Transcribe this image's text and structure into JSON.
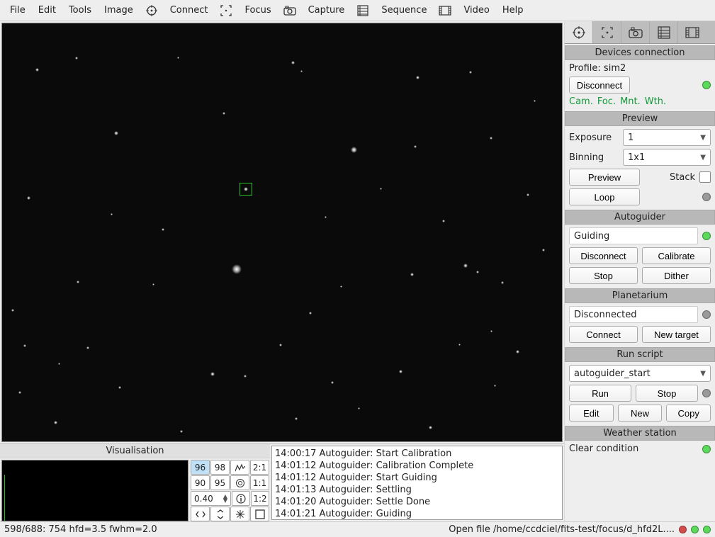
{
  "menu": {
    "file": "File",
    "edit": "Edit",
    "tools": "Tools",
    "image": "Image",
    "connect": "Connect",
    "focus": "Focus",
    "capture": "Capture",
    "sequence": "Sequence",
    "video": "Video",
    "help": "Help"
  },
  "tabs": {
    "active_index": 0
  },
  "devices": {
    "title": "Devices connection",
    "profile_label": "Profile: sim2",
    "disconnect": "Disconnect",
    "status_line": {
      "cam": "Cam.",
      "foc": "Foc.",
      "mnt": "Mnt.",
      "wth": "Wth."
    },
    "led": "green"
  },
  "preview": {
    "title": "Preview",
    "exposure_label": "Exposure",
    "exposure_value": "1",
    "binning_label": "Binning",
    "binning_value": "1x1",
    "preview_btn": "Preview",
    "stack_label": "Stack",
    "loop_btn": "Loop",
    "loop_led": "gray"
  },
  "autoguider": {
    "title": "Autoguider",
    "status_text": "Guiding",
    "status_led": "green",
    "disconnect": "Disconnect",
    "calibrate": "Calibrate",
    "stop": "Stop",
    "dither": "Dither"
  },
  "planetarium": {
    "title": "Planetarium",
    "status_text": "Disconnected",
    "status_led": "gray",
    "connect": "Connect",
    "newtarget": "New target"
  },
  "runscript": {
    "title": "Run script",
    "script_value": "autoguider_start",
    "run": "Run",
    "stop": "Stop",
    "led": "gray",
    "edit": "Edit",
    "new": "New",
    "copy": "Copy"
  },
  "weather": {
    "title": "Weather station",
    "status_text": "Clear condition",
    "led": "green"
  },
  "visualisation": {
    "title": "Visualisation",
    "btns": {
      "b96": "96",
      "b98": "98",
      "ratio21": "2:1",
      "b90": "90",
      "b95": "95",
      "ratio11": "1:1",
      "spin": "0.40",
      "ratio12": "1:2"
    }
  },
  "log": [
    "14:00:17 Autoguider: Start Calibration",
    "14:01:12 Autoguider: Calibration Complete",
    "14:01:12 Autoguider: Start Guiding",
    "14:01:13 Autoguider: Settling",
    "14:01:20 Autoguider: Settle Done",
    "14:01:21 Autoguider: Guiding"
  ],
  "statusbar": {
    "left": "598/688: 754 hfd=3.5 fwhm=2.0",
    "right": "Open file /home/ccdciel/fits-test/focus/d_hfd2L...."
  }
}
